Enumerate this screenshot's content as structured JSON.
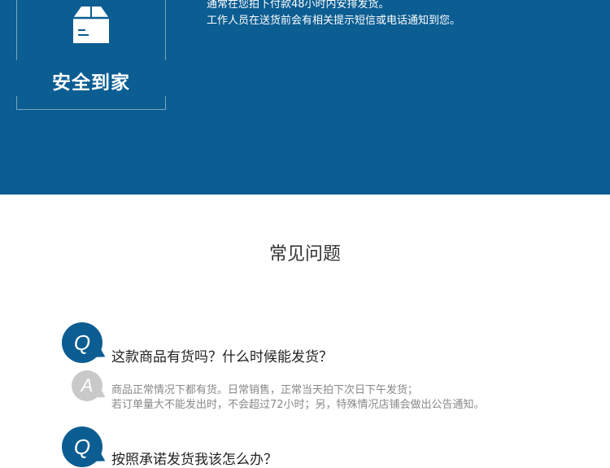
{
  "banner": {
    "card_label": "安全到家",
    "card_icon": "box-icon",
    "line1": "通常在您拍下付款48小时内安排发货。",
    "line2": "工作人员在送货前会有相关提示短信或电话通知到您。",
    "background_color": "#0b5d92"
  },
  "faq": {
    "title": "常见问题",
    "q_badge": "Q",
    "a_badge": "A",
    "items": [
      {
        "question": "这款商品有货吗？什么时候能发货？",
        "answer_line1": "商品正常情况下都有货。日常销售，正常当天拍下次日下午发货；",
        "answer_line2": "若订单量大不能发出时，不会超过72小时；另，特殊情况店铺会做出公告通知。"
      },
      {
        "question": "按照承诺发货我该怎么办？"
      }
    ]
  }
}
